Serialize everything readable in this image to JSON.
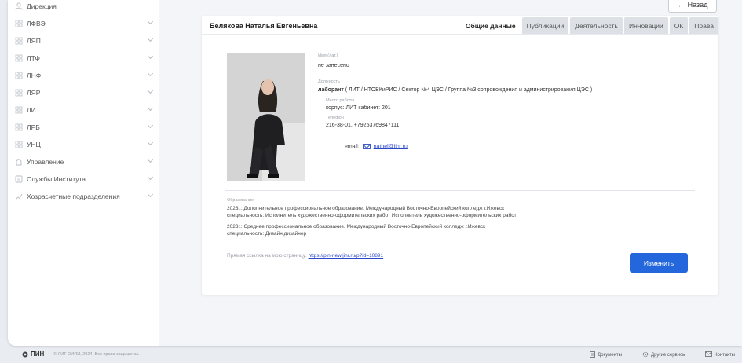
{
  "sidebar": {
    "items": [
      {
        "label": "Дирекция",
        "icon": "person-icon",
        "chevron": false
      },
      {
        "label": "ЛФВЭ",
        "icon": "lab-icon",
        "chevron": true
      },
      {
        "label": "ЛЯП",
        "icon": "lab-icon",
        "chevron": true
      },
      {
        "label": "ЛТФ",
        "icon": "lab-icon",
        "chevron": true
      },
      {
        "label": "ЛНФ",
        "icon": "lab-icon",
        "chevron": true
      },
      {
        "label": "ЛЯР",
        "icon": "lab-icon",
        "chevron": true
      },
      {
        "label": "ЛИТ",
        "icon": "lab-icon",
        "chevron": true
      },
      {
        "label": "ЛРБ",
        "icon": "lab-icon",
        "chevron": true
      },
      {
        "label": "УНЦ",
        "icon": "lab-icon",
        "chevron": true
      },
      {
        "label": "Управление",
        "icon": "management-icon",
        "chevron": true
      },
      {
        "label": "Службы Института",
        "icon": "services-icon",
        "chevron": true
      },
      {
        "label": "Хозрасчетные подразделения",
        "icon": "chart-icon",
        "chevron": true
      }
    ]
  },
  "header": {
    "back_label": "Назад",
    "back_arrow": "←"
  },
  "profile": {
    "name": "Белякова Наталья Евгеньевна",
    "tabs": [
      "Общие данные",
      "Публикации",
      "Деятельность",
      "Инновации",
      "ОК",
      "Права"
    ],
    "active_tab": 0,
    "name_lat_label": "Имя (лат.)",
    "name_lat_value": "не занесено",
    "position_label": "Должность",
    "position_title": "лаборант",
    "position_path": " ( ЛИТ / НТОВКиРИС / Сектор №4 ЦЭС / Группа №3 сопровождения и администрирования ЦЭС )",
    "workplace_label": "Место работы",
    "workplace_value": "корпус: ЛИТ  кабинет: 201",
    "phone_label": "Телефон",
    "phone_value": "216-38-01, +79253769847111",
    "email_label": "email:",
    "email_value": "natbel@jinr.ru",
    "education_label": "Образование",
    "education_lines": [
      "2023г.: Дополнительное профессиональное образование. Международный Восточно-Европейский колледж г.Ижевск",
      "специальность: Исполнитель художественно-оформительских работ Исполнитель художественно-оформительских работ",
      "2023г.: Среднее профессиональное образование. Международный Восточно-Европейский колледж г.Ижевск",
      "специальность: Дизайн дизайнер"
    ],
    "direct_link_label": "Прямая ссылка на мою страницу:",
    "direct_link_value": "https://pin-new.jinr.ru/p?id=10891",
    "edit_label": "Изменить"
  },
  "footer": {
    "logo": "ПИН",
    "copyright": "© ЛИТ ОИЯИ, 2024. Все права защищены.",
    "documents": "Документы",
    "other_services": "Другие сервисы",
    "contacts": "Контакты"
  },
  "colors": {
    "accent": "#2467dc",
    "link": "#2a48c9",
    "background": "#f3f5f8"
  }
}
